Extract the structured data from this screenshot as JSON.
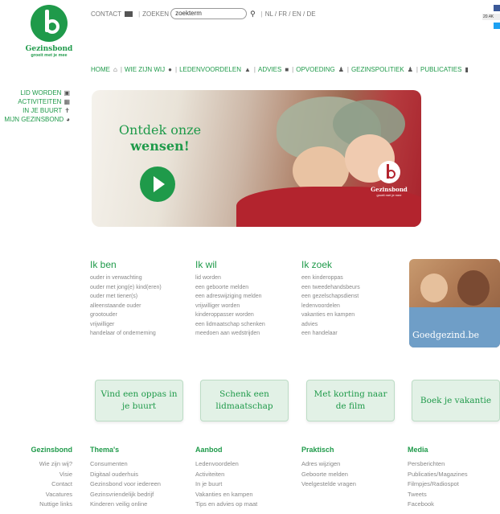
{
  "logo": {
    "name": "Gezinsbond",
    "tagline": "groeit met je mee"
  },
  "topbar": {
    "contact": "CONTACT",
    "search_label": "ZOEKEN",
    "search_value": "zoekterm",
    "languages": "NL / FR / EN / DE"
  },
  "social": {
    "count": "20.4K"
  },
  "mainnav": [
    {
      "label": "HOME",
      "icon": "home-icon"
    },
    {
      "label": "WIE ZIJN WIJ",
      "icon": "info-icon"
    },
    {
      "label": "LEDENVOORDELEN",
      "icon": "user-icon"
    },
    {
      "label": "ADVIES",
      "icon": "chat-icon"
    },
    {
      "label": "OPVOEDING",
      "icon": "family-icon"
    },
    {
      "label": "GEZINSPOLITIEK",
      "icon": "people-icon"
    },
    {
      "label": "PUBLICATIES",
      "icon": "book-icon"
    }
  ],
  "sidenav": [
    {
      "label": "LID WORDEN",
      "icon": "card-icon"
    },
    {
      "label": "ACTIVITEITEN",
      "icon": "calendar-icon"
    },
    {
      "label": "IN JE BUURT",
      "icon": "signpost-icon"
    },
    {
      "label": "MIJN GEZINSBOND",
      "icon": "logo-icon"
    }
  ],
  "hero": {
    "line1": "Ontdek onze",
    "line2": "wensen!",
    "logo_name": "Gezinsbond",
    "logo_tag": "groeit met je mee"
  },
  "columns": [
    {
      "title": "Ik ben",
      "items": [
        "ouder in verwachting",
        "ouder met jong(e) kind(eren)",
        "ouder met tiener(s)",
        "alleenstaande ouder",
        "grootouder",
        "vrijwilliger",
        "handelaar of onderneming"
      ]
    },
    {
      "title": "Ik wil",
      "items": [
        "lid worden",
        "een geboorte melden",
        "een adreswijziging melden",
        "vrijwilliger worden",
        "kinderoppasser worden",
        "een lidmaatschap schenken",
        "meedoen aan wedstrijden"
      ]
    },
    {
      "title": "Ik zoek",
      "items": [
        "een kinderoppas",
        "een tweedehandsbeurs",
        "een gezelschapsdienst",
        "ledenvoordelen",
        "vakanties en kampen",
        "advies",
        "een handelaar"
      ]
    }
  ],
  "promo": {
    "text": "Goedgezind.be"
  },
  "cta": [
    "Vind een oppas in je buurt",
    "Schenk een lidmaatschap",
    "Met korting naar de film",
    "Boek je vakantie"
  ],
  "footer": [
    {
      "title": "Gezinsbond",
      "items": [
        "Wie zijn wij?",
        "Visie",
        "Contact",
        "Vacatures",
        "Nuttige links"
      ]
    },
    {
      "title": "Thema's",
      "items": [
        "Consumenten",
        "Digitaal ouderhuis",
        "Gezinsbond voor iedereen",
        "Gezinsvriendelijk bedrijf",
        "Kinderen veilig online"
      ]
    },
    {
      "title": "Aanbod",
      "items": [
        "Ledenvoordelen",
        "Activiteiten",
        "In je buurt",
        "Vakanties en kampen",
        "Tips en advies op maat"
      ]
    },
    {
      "title": "Praktisch",
      "items": [
        "Adres wijzigen",
        "Geboorte melden",
        "Veelgestelde vragen"
      ]
    },
    {
      "title": "Media",
      "items": [
        "Persberichten",
        "Publicaties/Magazines",
        "Filmpjes/Radiospot",
        "Tweets",
        "Facebook"
      ]
    }
  ]
}
